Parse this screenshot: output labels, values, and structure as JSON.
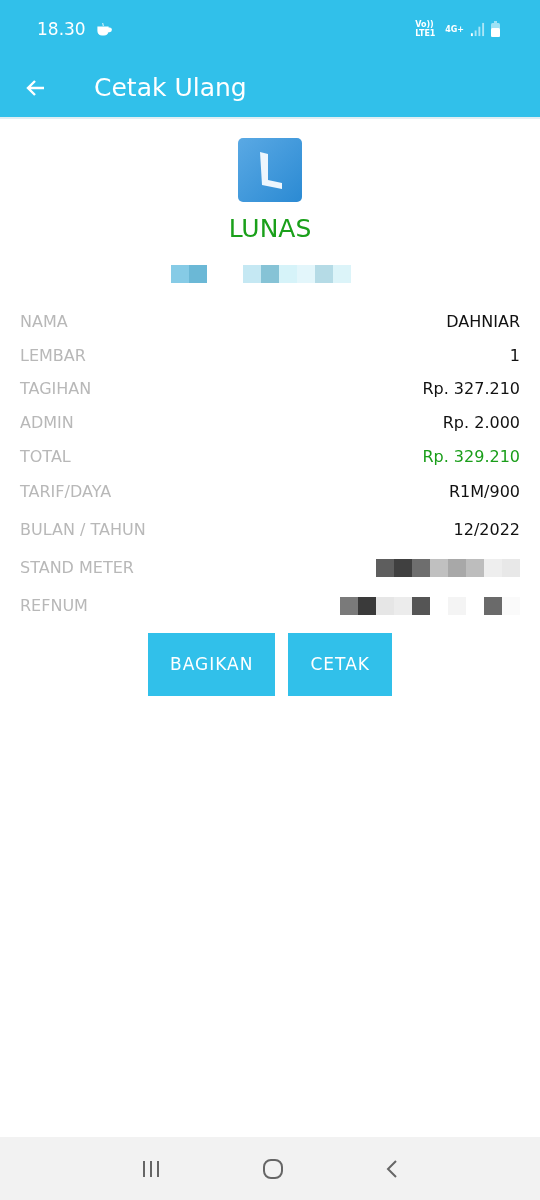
{
  "status_bar": {
    "time": "18.30",
    "network_label": "Vo)) LTE1",
    "network_type": "4G+"
  },
  "app_bar": {
    "title": "Cetak Ulang"
  },
  "receipt": {
    "status": "LUNAS",
    "rows": [
      {
        "label": "NAMA",
        "kind": "text",
        "value": "DAHNIAR",
        "highlighted": false
      },
      {
        "label": "LEMBAR",
        "kind": "text",
        "value": "1",
        "highlighted": false
      },
      {
        "label": "TAGIHAN",
        "kind": "text",
        "value": "Rp. 327.210",
        "highlighted": false
      },
      {
        "label": "ADMIN",
        "kind": "text",
        "value": "Rp. 2.000",
        "highlighted": false
      },
      {
        "label": "TOTAL",
        "kind": "text",
        "value": "Rp. 329.210",
        "highlighted": true
      },
      {
        "label": "TARIF/DAYA",
        "kind": "text",
        "value": "R1M/900",
        "highlighted": false
      },
      {
        "label": "BULAN / TAHUN",
        "kind": "text",
        "value": "12/2022",
        "highlighted": false
      },
      {
        "label": "STAND METER",
        "kind": "redacted"
      },
      {
        "label": "REFNUM",
        "kind": "redacted"
      }
    ]
  },
  "buttons": [
    "BAGIKAN",
    "CETAK"
  ]
}
